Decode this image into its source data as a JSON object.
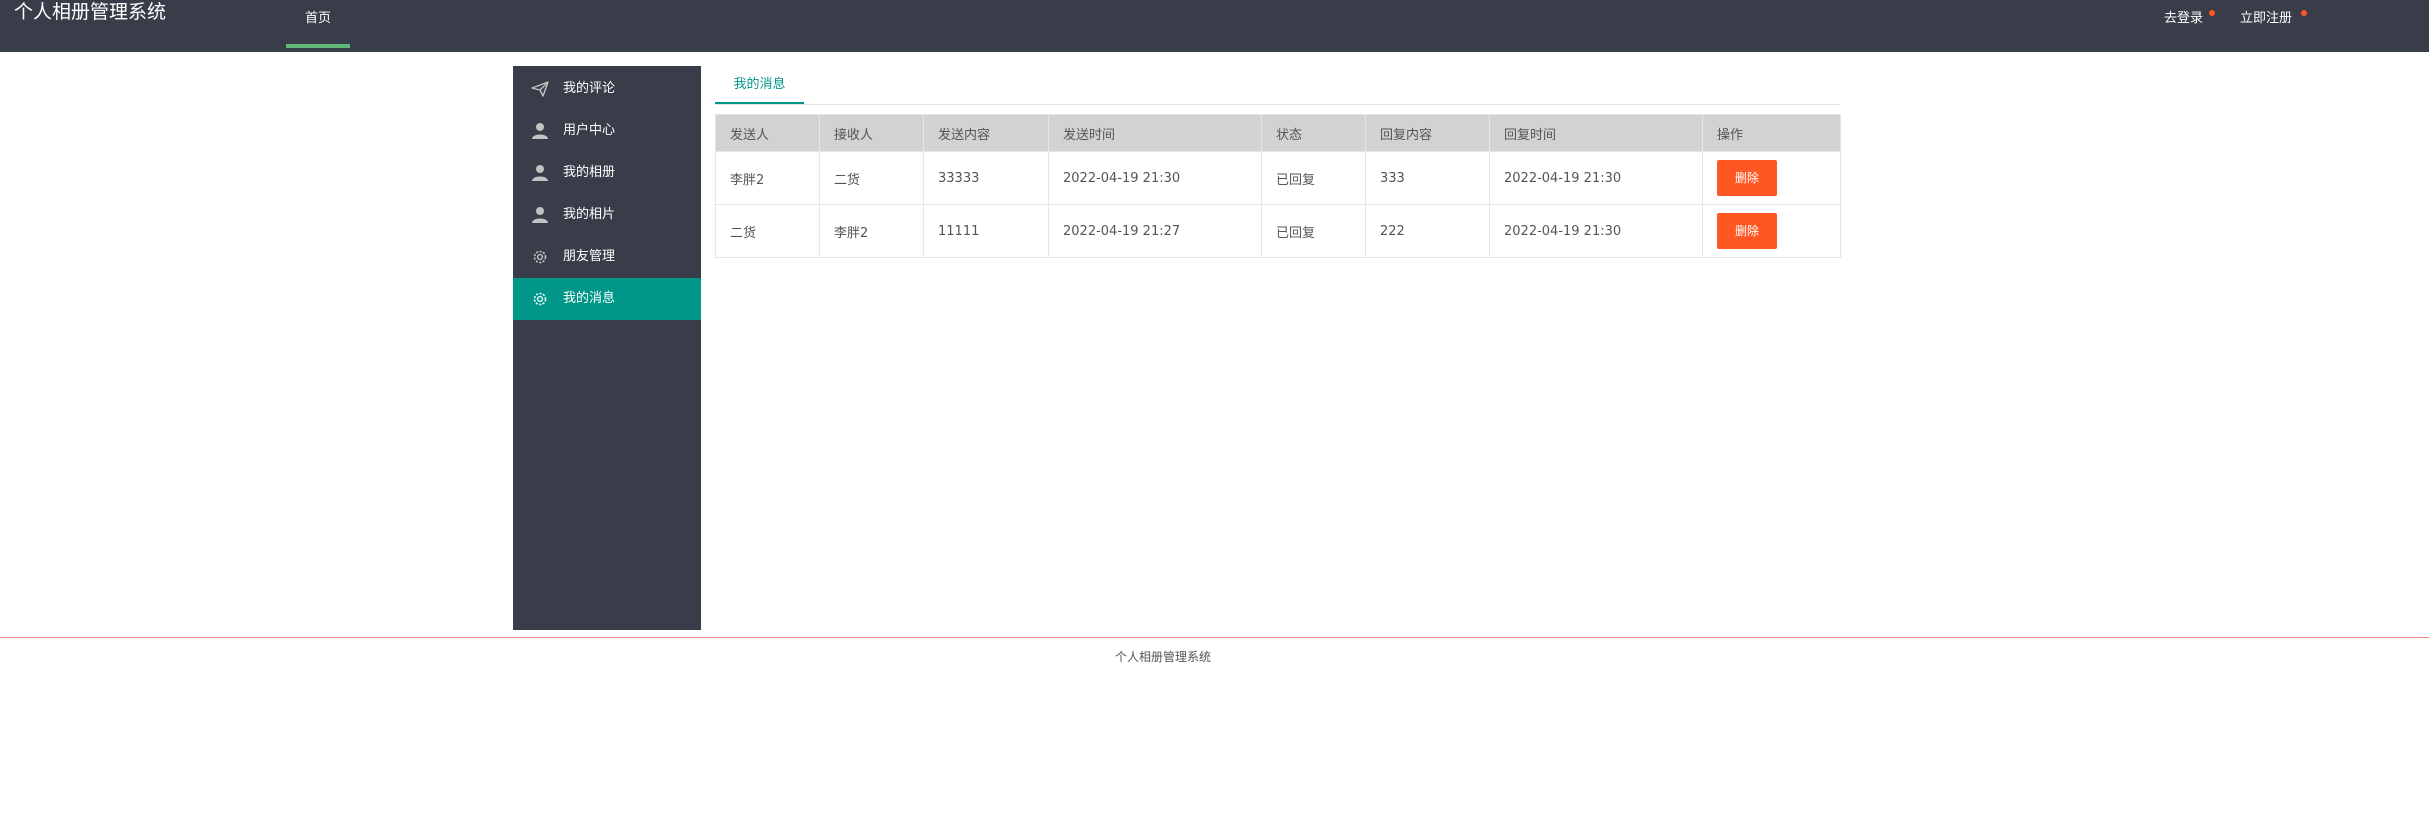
{
  "header": {
    "app_title": "个人相册管理系统",
    "nav_home": "首页",
    "login": "去登录",
    "register": "立即注册"
  },
  "sidebar": {
    "items": [
      {
        "label": "我的评论",
        "icon": "send-icon"
      },
      {
        "label": "用户中心",
        "icon": "user-icon"
      },
      {
        "label": "我的相册",
        "icon": "user-icon"
      },
      {
        "label": "我的相片",
        "icon": "user-icon"
      },
      {
        "label": "朋友管理",
        "icon": "gear-icon"
      },
      {
        "label": "我的消息",
        "icon": "gear-icon",
        "active": true
      }
    ]
  },
  "main": {
    "tab_label": "我的消息",
    "table": {
      "columns": [
        "发送人",
        "接收人",
        "发送内容",
        "发送时间",
        "状态",
        "回复内容",
        "回复时间",
        "操作"
      ],
      "rows": [
        {
          "sender": "李胖2",
          "receiver": "二货",
          "content": "33333",
          "send_time": "2022-04-19 21:30",
          "status": "已回复",
          "reply": "333",
          "reply_time": "2022-04-19 21:30",
          "action": "删除"
        },
        {
          "sender": "二货",
          "receiver": "李胖2",
          "content": "11111",
          "send_time": "2022-04-19 21:27",
          "status": "已回复",
          "reply": "222",
          "reply_time": "2022-04-19 21:30",
          "action": "删除"
        }
      ]
    }
  },
  "footer": {
    "text": "个人相册管理系统"
  },
  "colors": {
    "header_bg": "#393d49",
    "sidebar_bg": "#393d49",
    "active_item": "#009688",
    "nav_indicator": "#5fb878",
    "delete_button": "#ff5722",
    "notice_dot": "#ff5722",
    "table_header_bg": "#d2d2d2",
    "footer_line": "#f08080"
  }
}
